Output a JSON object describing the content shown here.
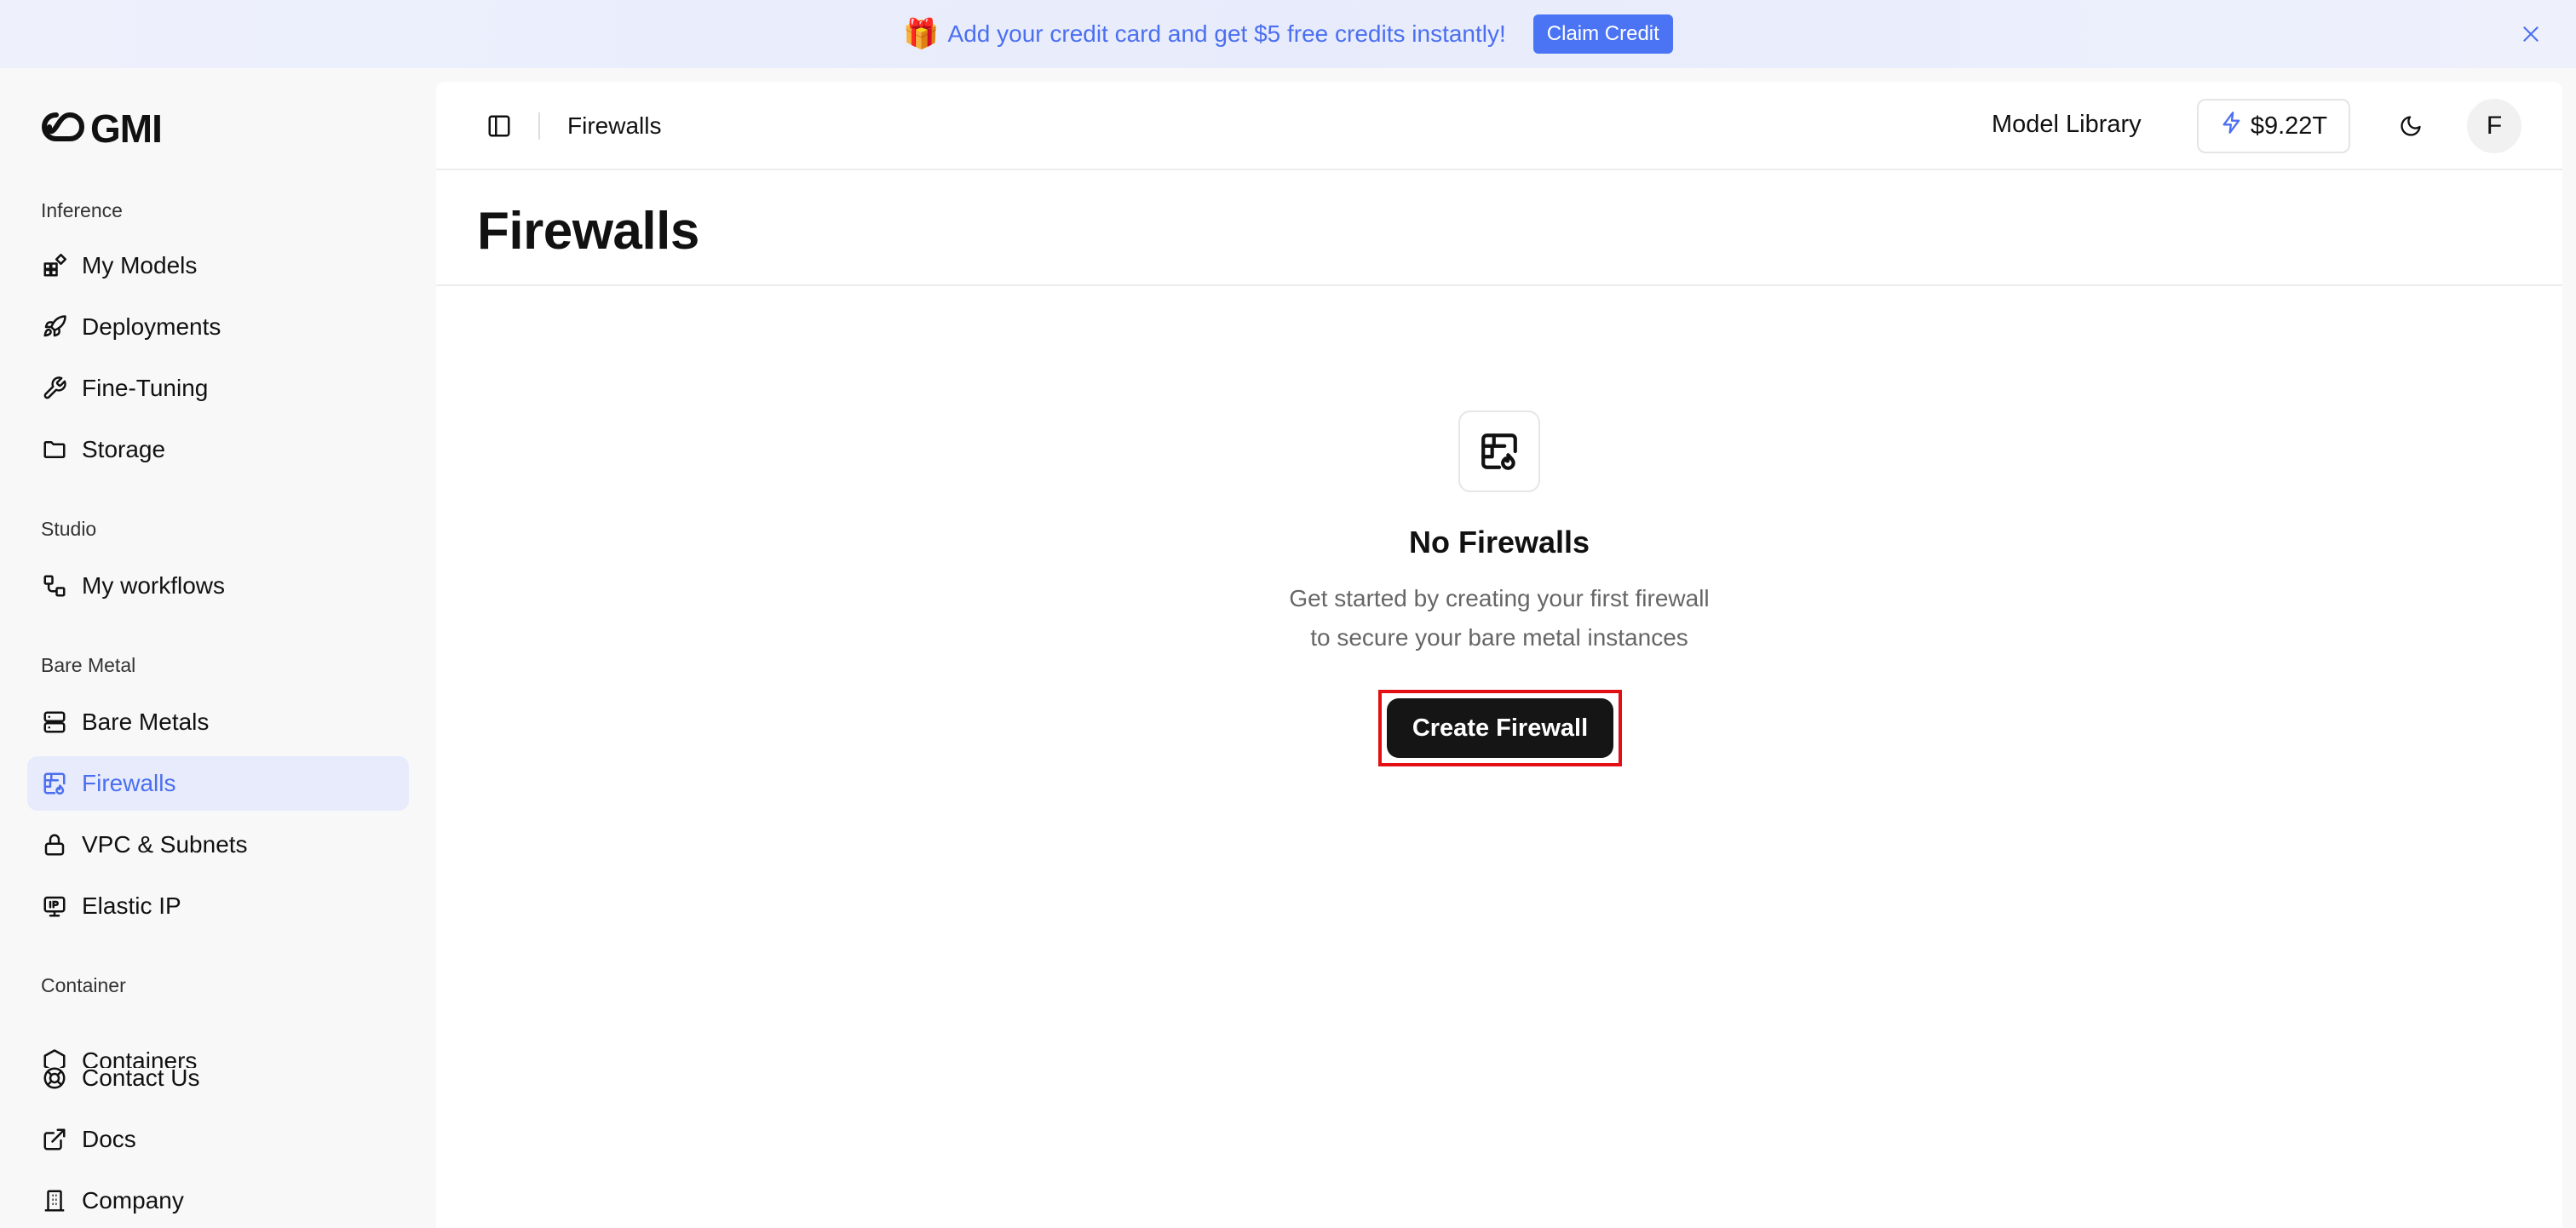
{
  "promo": {
    "gift_emoji": "🎁",
    "text": "Add your credit card and get $5 free credits instantly!",
    "button_label": "Claim Credit"
  },
  "sidebar": {
    "logo_text": "GMI",
    "sections": {
      "inference": "Inference",
      "studio": "Studio",
      "bare_metal": "Bare Metal",
      "container": "Container"
    },
    "items": {
      "my_models": "My Models",
      "deployments": "Deployments",
      "fine_tuning": "Fine-Tuning",
      "storage": "Storage",
      "my_workflows": "My workflows",
      "bare_metals": "Bare Metals",
      "firewalls": "Firewalls",
      "vpc_subnets": "VPC & Subnets",
      "elastic_ip": "Elastic IP",
      "containers": "Containers",
      "contact_us": "Contact Us",
      "docs": "Docs",
      "company": "Company"
    },
    "active_item": "firewalls"
  },
  "topbar": {
    "breadcrumb": "Firewalls",
    "model_library": "Model Library",
    "credits": "$9.22T",
    "avatar_initial": "F"
  },
  "page": {
    "title": "Firewalls"
  },
  "empty_state": {
    "title": "No Firewalls",
    "desc_line1": "Get started by creating your first firewall",
    "desc_line2": "to secure your bare metal instances",
    "button_label": "Create Firewall"
  },
  "colors": {
    "accent": "#4b6ff0",
    "active_bg": "#e7ebfb",
    "highlight_border": "#e30f14",
    "primary_button": "#151515"
  }
}
